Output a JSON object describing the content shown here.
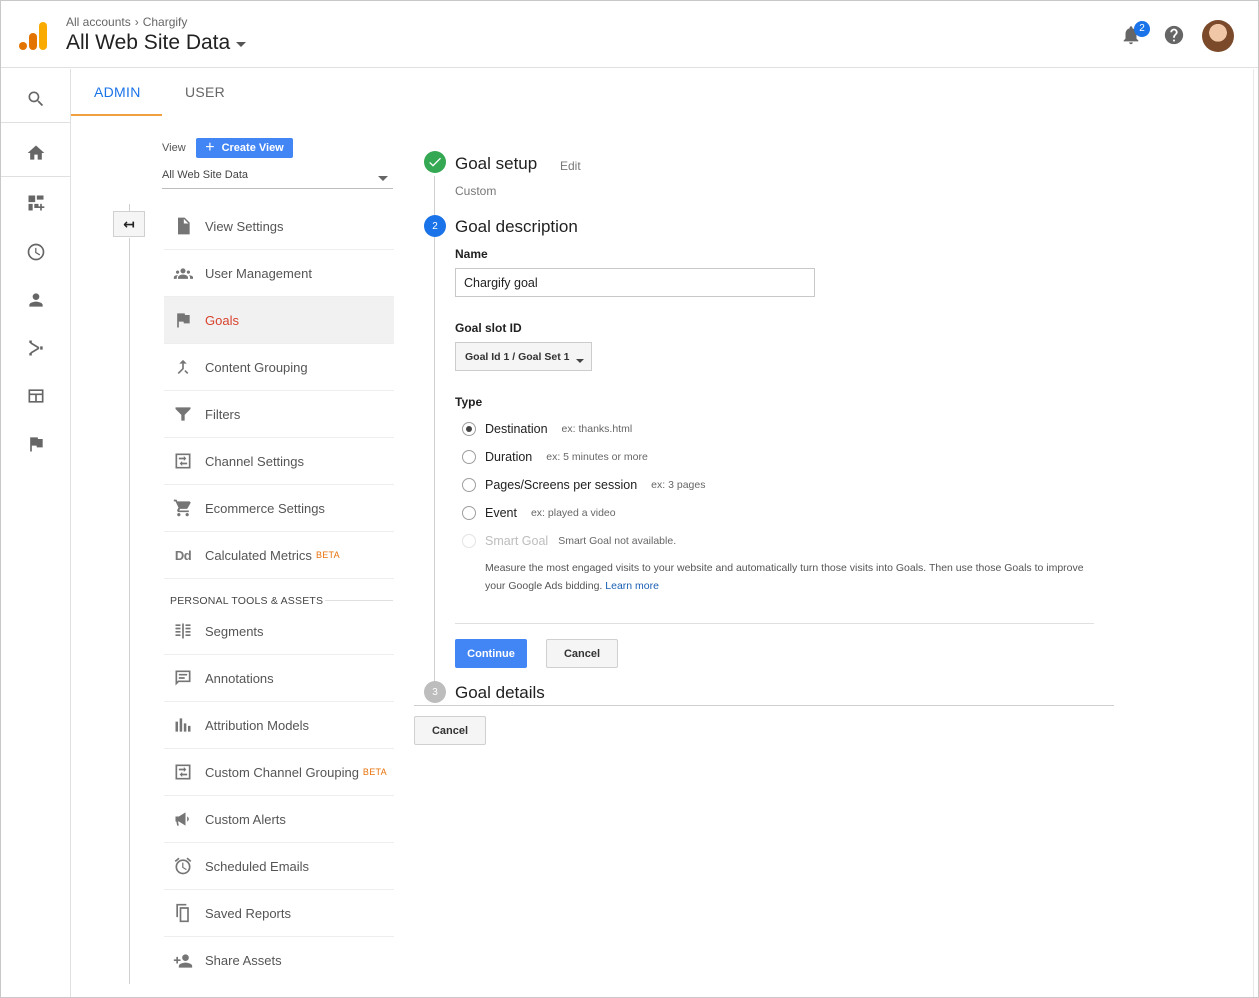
{
  "header": {
    "breadcrumb_root": "All accounts",
    "breadcrumb_account": "Chargify",
    "view_name": "All Web Site Data",
    "notification_count": "2"
  },
  "tabs": [
    {
      "label": "ADMIN",
      "active": true
    },
    {
      "label": "USER",
      "active": false
    }
  ],
  "view_panel": {
    "label": "View",
    "create_view": "Create View",
    "selected_view": "All Web Site Data"
  },
  "admin_items": [
    {
      "label": "View Settings",
      "icon": "document-icon"
    },
    {
      "label": "User Management",
      "icon": "people-icon"
    },
    {
      "label": "Goals",
      "icon": "flag-icon",
      "selected": true
    },
    {
      "label": "Content Grouping",
      "icon": "merge-icon"
    },
    {
      "label": "Filters",
      "icon": "filter-icon"
    },
    {
      "label": "Channel Settings",
      "icon": "channel-icon"
    },
    {
      "label": "Ecommerce Settings",
      "icon": "cart-icon"
    },
    {
      "label": "Calculated Metrics",
      "icon": "dd-icon",
      "badge": "BETA"
    }
  ],
  "personal_section": {
    "title": "PERSONAL TOOLS & ASSETS",
    "items": [
      {
        "label": "Segments",
        "icon": "segments-icon"
      },
      {
        "label": "Annotations",
        "icon": "annotation-icon"
      },
      {
        "label": "Attribution Models",
        "icon": "bars-icon"
      },
      {
        "label": "Custom Channel Grouping",
        "icon": "channel-icon",
        "badge": "BETA"
      },
      {
        "label": "Custom Alerts",
        "icon": "megaphone-icon"
      },
      {
        "label": "Scheduled Emails",
        "icon": "alarm-icon"
      },
      {
        "label": "Saved Reports",
        "icon": "copy-icon"
      },
      {
        "label": "Share Assets",
        "icon": "person-add-icon"
      }
    ]
  },
  "goal_wizard": {
    "step1": {
      "title": "Goal setup",
      "edit": "Edit",
      "summary": "Custom"
    },
    "step2": {
      "number": "2",
      "title": "Goal description",
      "name_label": "Name",
      "name_value": "Chargify goal",
      "slot_label": "Goal slot ID",
      "slot_value": "Goal Id 1 / Goal Set 1",
      "type_label": "Type",
      "types": [
        {
          "label": "Destination",
          "example": "ex: thanks.html",
          "checked": true
        },
        {
          "label": "Duration",
          "example": "ex: 5 minutes or more"
        },
        {
          "label": "Pages/Screens per session",
          "example": "ex: 3 pages"
        },
        {
          "label": "Event",
          "example": "ex: played a video"
        },
        {
          "label": "Smart Goal",
          "example": "Smart Goal not available.",
          "disabled": true
        }
      ],
      "smart_note": "Measure the most engaged visits to your website and automatically turn those visits into Goals. Then use those Goals to improve your Google Ads bidding.",
      "learn_more": "Learn more",
      "continue": "Continue",
      "cancel": "Cancel"
    },
    "step3": {
      "number": "3",
      "title": "Goal details"
    },
    "cancel": "Cancel"
  },
  "colors": {
    "accent": "#4285f4",
    "selected_text": "#d8432e",
    "tab_underline": "#f0a040",
    "step_done": "#34a853",
    "step_active": "#1a73e8",
    "step_pending": "#bdbdbd"
  }
}
